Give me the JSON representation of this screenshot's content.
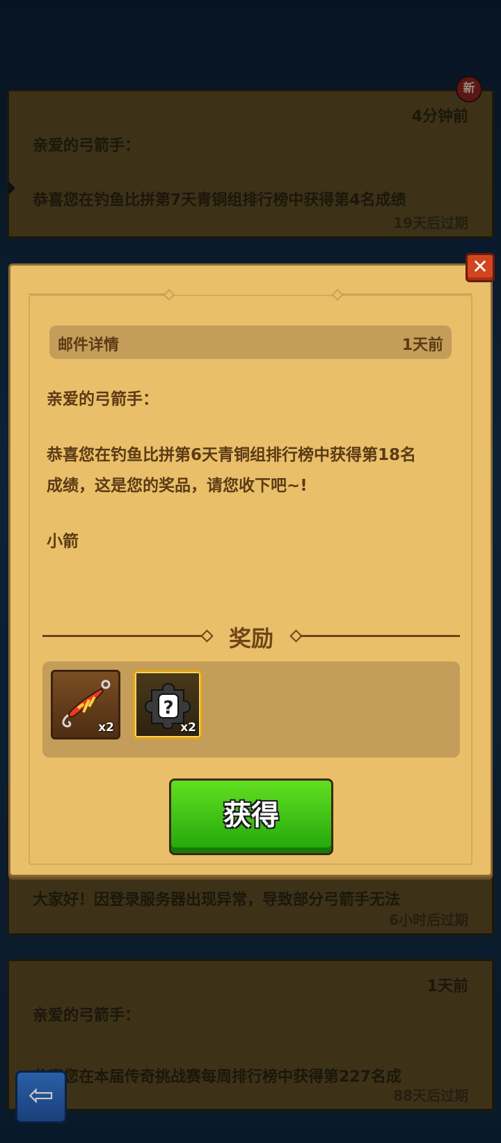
{
  "mail_list": [
    {
      "time": "4分钟前",
      "greeting": "亲爱的弓箭手：",
      "body": "恭喜您在钓鱼比拼第7天青铜组排行榜中获得第4名成绩",
      "expire": "19天后过期",
      "badge": "新"
    },
    {
      "time": "",
      "greeting": "",
      "body": "大家好！因登录服务器出现异常，导致部分弓箭手无法",
      "expire": "6小时后过期"
    },
    {
      "time": "1天前",
      "greeting": "亲爱的弓箭手：",
      "body": "恭喜您在本届传奇挑战赛每周排行榜中获得第227名成",
      "expire": "88天后过期"
    }
  ],
  "detail": {
    "title": "邮件详情",
    "time": "1天前",
    "greeting": "亲爱的弓箭手：",
    "body_line1": "恭喜您在钓鱼比拼第6天青铜组排行榜中获得第18名",
    "body_line2": "成绩，这是您的奖品，请您收下吧~!",
    "signature": "小箭",
    "close_icon": "✕",
    "reward_title": "奖励",
    "rewards": [
      {
        "icon": "fishing-lure-icon",
        "qty": "x2"
      },
      {
        "icon": "mystery-puzzle-piece-icon",
        "qty": "x2"
      }
    ],
    "claim_label": "获得"
  },
  "back_icon": "⇦"
}
